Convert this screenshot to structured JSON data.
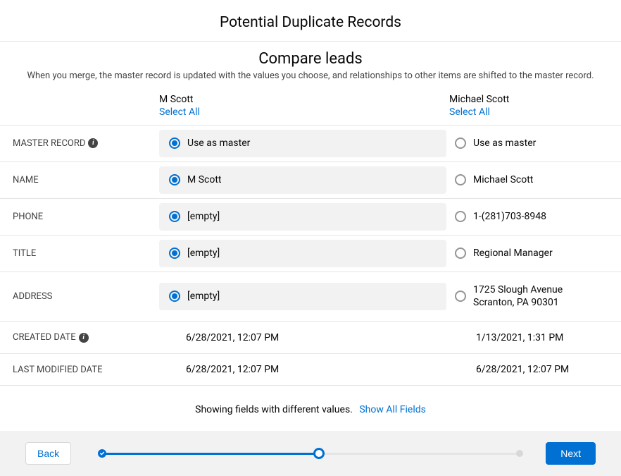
{
  "page_title": "Potential Duplicate Records",
  "section_title": "Compare leads",
  "section_desc": "When you merge, the master record is updated with the values you choose, and relationships to other items are shifted to the master record.",
  "columns": {
    "a": {
      "name": "M Scott",
      "select_all": "Select All"
    },
    "b": {
      "name": "Michael Scott",
      "select_all": "Select All"
    }
  },
  "rows": {
    "master": {
      "label": "MASTER RECORD",
      "a": "Use as master",
      "b": "Use as master"
    },
    "name_row": {
      "label": "NAME",
      "a": "M Scott",
      "b": "Michael Scott"
    },
    "phone": {
      "label": "PHONE",
      "a": "[empty]",
      "b": "1-(281)703-8948"
    },
    "title_row": {
      "label": "TITLE",
      "a": "[empty]",
      "b": "Regional Manager"
    },
    "address": {
      "label": "ADDRESS",
      "a": "[empty]",
      "b_line1": "1725 Slough Avenue",
      "b_line2": "Scranton, PA 90301"
    },
    "created": {
      "label": "CREATED DATE",
      "a": "6/28/2021, 12:07 PM",
      "b": "1/13/2021, 1:31 PM"
    },
    "modified": {
      "label": "LAST MODIFIED DATE",
      "a": "6/28/2021, 12:07 PM",
      "b": "6/28/2021, 12:07 PM"
    }
  },
  "footer_showing": "Showing fields with different values.",
  "footer_link": "Show All Fields",
  "buttons": {
    "back": "Back",
    "next": "Next"
  }
}
